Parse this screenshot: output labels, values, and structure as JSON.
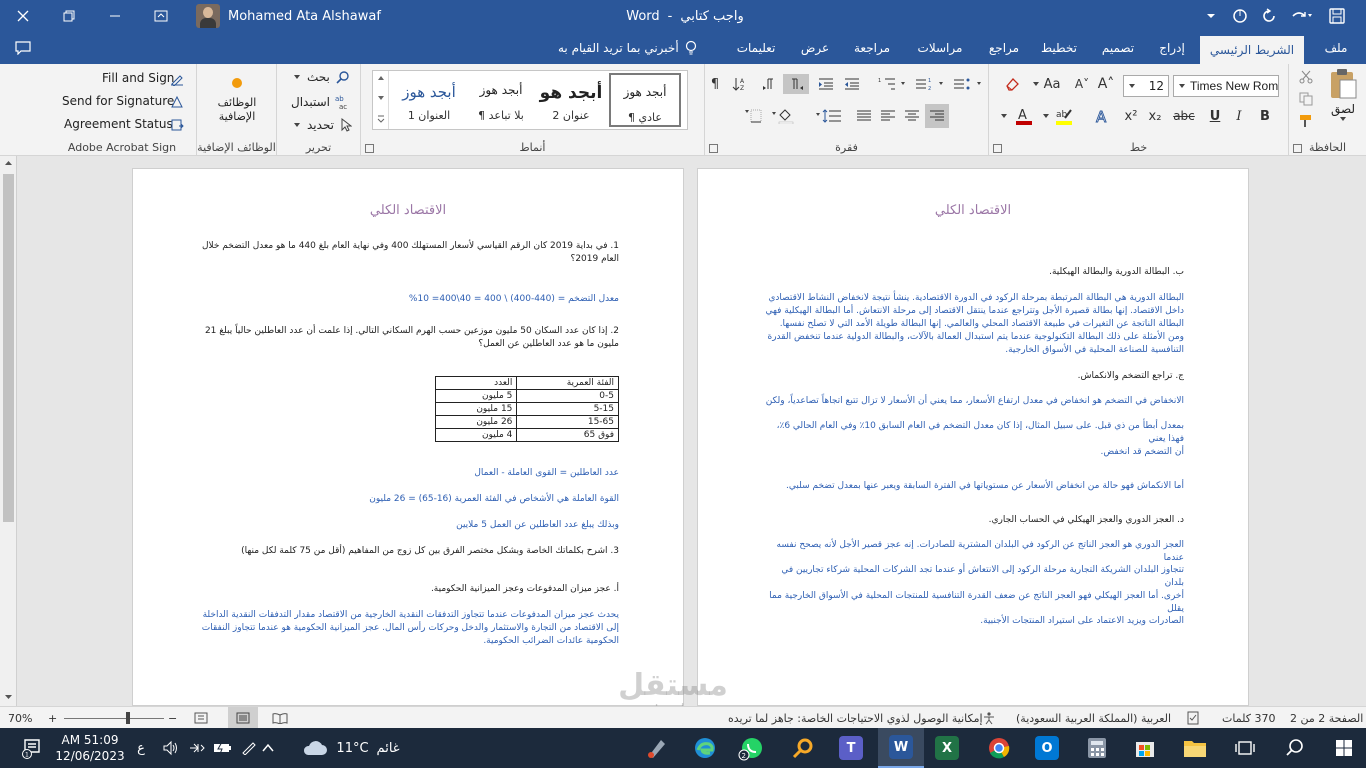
{
  "titlebar": {
    "doc_name": "واجب كتابي",
    "separator": "-",
    "app_name": "Word",
    "user_name": "Mohamed Ata Alshawaf"
  },
  "tabs": [
    {
      "id": "file",
      "label": "ملف"
    },
    {
      "id": "home",
      "label": "الشريط الرئيسي",
      "active": true
    },
    {
      "id": "insert",
      "label": "إدراج"
    },
    {
      "id": "design",
      "label": "تصميم"
    },
    {
      "id": "layout",
      "label": "تخطيط"
    },
    {
      "id": "references",
      "label": "مراجع"
    },
    {
      "id": "mailings",
      "label": "مراسلات"
    },
    {
      "id": "review",
      "label": "مراجعة"
    },
    {
      "id": "view",
      "label": "عرض"
    },
    {
      "id": "help",
      "label": "تعليمات"
    }
  ],
  "tell_me": "أخبرني بما تريد القيام به",
  "ribbon": {
    "clipboard": {
      "paste": "لصق",
      "label": "الحافظة"
    },
    "font": {
      "name": "Times New Rom",
      "size": "12",
      "label": "خط"
    },
    "paragraph": {
      "label": "فقرة"
    },
    "styles": {
      "label": "أنماط",
      "items": [
        {
          "sample": "أبجد هوز",
          "name": "¶ عادي",
          "selected": true
        },
        {
          "sample": "أبجد هو",
          "name": "عنوان 2"
        },
        {
          "sample": "أبجد هوز",
          "name": "¶ بلا تباعد"
        },
        {
          "sample": "أبجد هوز",
          "name": "العنوان 1"
        }
      ]
    },
    "editing": {
      "find": "بحث",
      "replace": "استبدال",
      "select": "تحديد",
      "label": "تحرير"
    },
    "addins": {
      "button": "الوظائف الإضافية",
      "label": "الوظائف الإضافية"
    },
    "acrobat": {
      "fill_sign": "Fill and Sign",
      "send_signature": "Send for Signature",
      "agreement_status": "Agreement Status",
      "label": "Adobe Acrobat Sign"
    }
  },
  "page_right": {
    "title": "الاقتصاد الكلي",
    "paragraphs": [
      {
        "style": "dark",
        "text": "ب. البطالة الدورية والبطالة الهيكلية."
      },
      {
        "style": "blue",
        "text": "البطالة الدورية هي البطالة المرتبطة بمرحلة الركود في الدورة الاقتصادية. ينشأ نتيجة لانخفاض النشاط الاقتصادي داخل الاقتصاد. إنها بطالة قصيرة الأجل وتتراجع عندما ينتقل الاقتصاد إلى مرحلة الانتعاش. أما البطالة الهيكلية فهي البطالة الناتجة عن التغيرات في طبيعة الاقتصاد المحلي والعالمي. إنها البطالة طويلة الأمد التي لا تصلح نفسها. ومن الأمثلة على ذلك البطالة التكنولوجية عندما يتم استبدال العمالة بالآلات، والبطالة الدولية عندما تنخفض القدرة التنافسية للصناعة المحلية في الأسواق الخارجية."
      },
      {
        "style": "dark",
        "text": "ج. تراجع التضخم والانكماش."
      },
      {
        "style": "blue",
        "text": "الانخفاض في التضخم هو انخفاض في معدل ارتفاع الأسعار، مما يعني أن الأسعار لا تزال تتبع اتجاهاً تصاعدياً، ولكن"
      },
      {
        "style": "blue",
        "text": "بمعدل أبطأ من ذي قبل. على سبيل المثال، إذا كان معدل التضخم في العام السابق 10٪ وفي العام الحالي 6٪، فهذا يعني"
      },
      {
        "style": "blue",
        "text": "أن التضخم قد انخفض."
      },
      {
        "style": "blue",
        "text": "أما الانكماش فهو حالة من انخفاض الأسعار عن مستوياتها في الفترة السابقة ويعبر عنها بمعدل تضخم سلبي."
      },
      {
        "style": "dark",
        "text": "د. العجز الدوري والعجز الهيكلي في الحساب الجاري."
      },
      {
        "style": "blue",
        "text": "العجز الدوري هو العجز الناتج عن الركود في البلدان المشترية للصادرات. إنه عجز قصير الأجل لأنه يصحح نفسه عندما"
      },
      {
        "style": "blue",
        "text": "تتجاوز البلدان الشريكة التجارية مرحلة الركود إلى الانتعاش أو عندما تجد الشركات المحلية شركاء تجاريين في بلدان"
      },
      {
        "style": "blue",
        "text": "أخرى. أما العجز الهيكلي فهو العجز الناتج عن ضعف القدرة التنافسية للمنتجات المحلية في الأسواق الخارجية مما يقلل"
      },
      {
        "style": "blue",
        "text": "الصادرات ويزيد الاعتماد على استيراد المنتجات الأجنبية."
      }
    ]
  },
  "page_left": {
    "title": "الاقتصاد الكلي",
    "q1": "1. في بداية 2019 كان الرقم القياسي لأسعار المستهلك 400 وفي نهاية العام بلغ 440 ما هو معدل التضخم خلال العام 2019؟",
    "a1": "معدل التضخم = (440-400) \\ 400 = 40\\400= 10%",
    "q2": "2. إذا كان عدد السكان 50 مليون موزعين حسب الهرم السكاني التالي. إذا علمت أن عدد العاطلين حالياً يبلغ 21 مليون ما هو عدد العاطلين عن العمل؟",
    "table": {
      "headers": [
        "الفئة العمرية",
        "العدد"
      ],
      "rows": [
        [
          "0-5",
          "5 مليون"
        ],
        [
          "5-15",
          "15 مليون"
        ],
        [
          "15-65",
          "26 مليون"
        ],
        [
          "فوق 65",
          "4 مليون"
        ]
      ]
    },
    "a2_lines": [
      "عدد العاطلين = القوى العاملة - العمال",
      "القوة العاملة هي الأشخاص في الفئة العمرية (16-65) = 26 مليون",
      "وبذلك يبلغ عدد العاطلين عن العمل 5 ملايين"
    ],
    "q3": "3. اشرح بكلماتك الخاصة وبشكل مختصر الفرق بين كل زوج من المفاهيم (أقل من 75 كلمة لكل منها)",
    "q3a": "أ. عجز ميزان المدفوعات وعجز الميزانية الحكومية.",
    "a3a": "يحدث عجز ميزان المدفوعات عندما تتجاوز التدفقات النقدية الخارجية من الاقتصاد مقدار التدفقات النقدية الداخلة إلى الاقتصاد من التجارة والاستثمار والدخل وحركات رأس المال. عجز الميزانية الحكومية هو عندما تتجاوز النفقات الحكومية عائدات الضرائب الحكومية."
  },
  "status": {
    "page": "الصفحة 2 من 2",
    "words": "370 كلمات",
    "language": "العربية (المملكة العربية السعودية)",
    "accessibility": "إمكانية الوصول لذوي الاحتياجات الخاصة: جاهز لما تريده",
    "zoom": "70%"
  },
  "taskbar": {
    "time": "AM 51:09",
    "date": "12/06/2023",
    "lang": "ع",
    "weather_temp": "11°C",
    "weather_text": "غائم",
    "teams_badge": "2",
    "notif_badge": "1"
  },
  "watermark": {
    "ar": "مستقل",
    "en": "mostaql.com"
  },
  "colors": {
    "word_blue": "#2b579a",
    "heading_purple": "#9b76a6",
    "answer_blue": "#2e5fb3",
    "taskbar": "#1c2a3c"
  }
}
